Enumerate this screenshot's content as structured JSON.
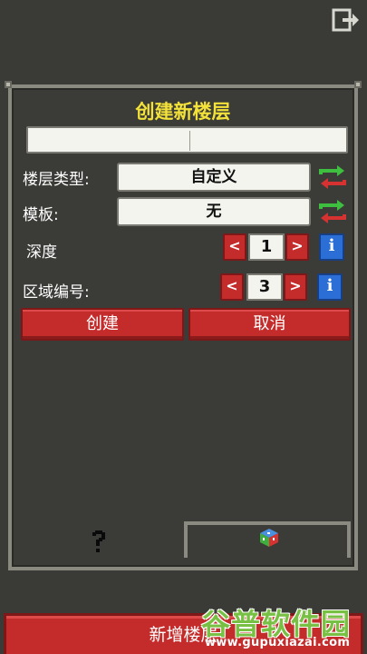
{
  "dialog": {
    "title": "创建新楼层",
    "name_input": {
      "value": "",
      "placeholder": ""
    },
    "floor_type": {
      "label": "楼层类型:",
      "value": "自定义"
    },
    "template": {
      "label": "模板:",
      "value": "无"
    },
    "depth": {
      "label": "深度",
      "value": "1",
      "decrement": "<",
      "increment": ">",
      "info": "i"
    },
    "region_number": {
      "label": "区域编号:",
      "value": "3",
      "decrement": "<",
      "increment": ">",
      "info": "i"
    },
    "create_label": "创建",
    "cancel_label": "取消"
  },
  "tabs": [
    {
      "icon": "question-mark-icon",
      "active": true
    },
    {
      "icon": "dice-cube-icon",
      "active": false
    }
  ],
  "footer": {
    "add_floor_label": "新增楼层"
  },
  "watermark": {
    "brand": "谷普软件园",
    "url": "www.gupuxiazai.com"
  },
  "colors": {
    "accent_red": "#c42b2b",
    "title_yellow": "#f2e23a",
    "info_blue": "#2b6fd6",
    "swap_green": "#3fbf3f",
    "swap_red": "#d63232"
  }
}
